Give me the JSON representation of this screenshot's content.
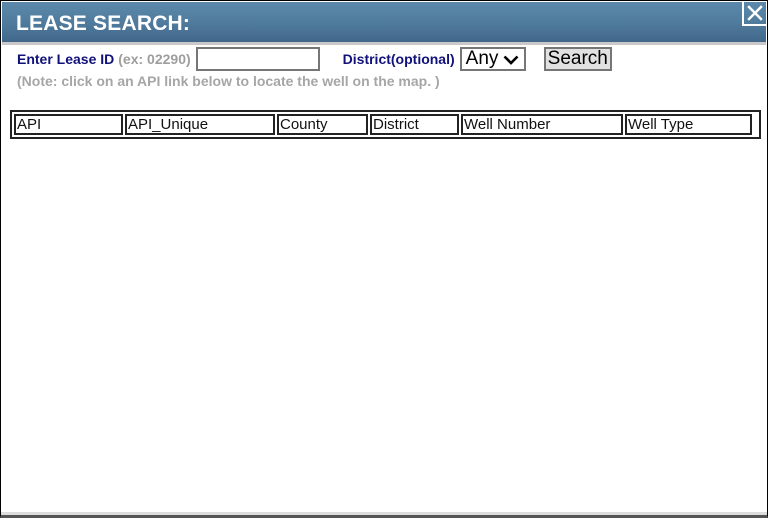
{
  "dialog": {
    "title": "LEASE SEARCH:",
    "close_icon": "close-x-icon"
  },
  "form": {
    "lease_label": "Enter Lease ID",
    "lease_hint": "(ex: 02290)",
    "lease_value": "",
    "lease_placeholder": "",
    "district_label": "District(optional)",
    "district_selected": "Any",
    "search_label": "Search",
    "note": "(Note: click on an API link below to locate the well on the map. )"
  },
  "table": {
    "columns": [
      "API",
      "API_Unique",
      "County",
      "District",
      "Well Number",
      "Well Type"
    ],
    "rows": []
  },
  "colors": {
    "titlebar": "#4f7a9c",
    "label": "#11117a",
    "hint": "#9e9e9e"
  }
}
